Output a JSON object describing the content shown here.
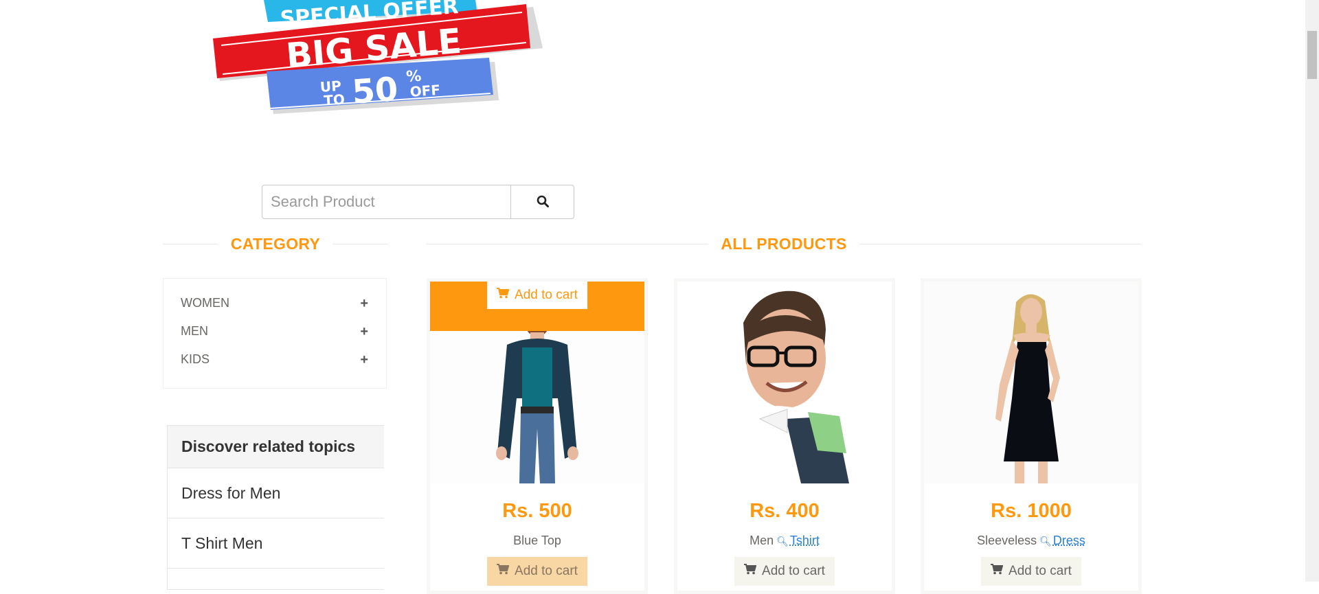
{
  "banner": {
    "line1": "SPECIAL OFFER",
    "line2": "BIG SALE",
    "line3_up": "UP",
    "line3_to": "TO",
    "line3_value": "50",
    "line3_percent": "%",
    "line3_off": "OFF",
    "colors": {
      "cyan": "#29b6e8",
      "red": "#e5171e",
      "blue": "#5b86e5"
    }
  },
  "search": {
    "placeholder": "Search Product",
    "icon": "search-icon"
  },
  "category": {
    "title": "CATEGORY",
    "items": [
      {
        "label": "WOMEN",
        "icon": "plus-icon"
      },
      {
        "label": "MEN",
        "icon": "plus-icon"
      },
      {
        "label": "KIDS",
        "icon": "plus-icon"
      }
    ]
  },
  "related": {
    "title": "Discover related topics",
    "items": [
      {
        "label": "Dress for Men"
      },
      {
        "label": "T Shirt Men"
      }
    ]
  },
  "products": {
    "title": "ALL PRODUCTS",
    "items": [
      {
        "price": "Rs. 500",
        "name": "Blue Top",
        "add_label": "Add to cart",
        "overlay_label": "Add to cart"
      },
      {
        "price": "Rs. 400",
        "name": "Men",
        "link": "Tshirt",
        "add_label": "Add to cart"
      },
      {
        "price": "Rs. 1000",
        "name": "Sleeveless",
        "link": "Dress",
        "add_label": "Add to cart"
      }
    ]
  },
  "colors": {
    "accent": "#FE980F",
    "link": "#2a7fd4"
  }
}
